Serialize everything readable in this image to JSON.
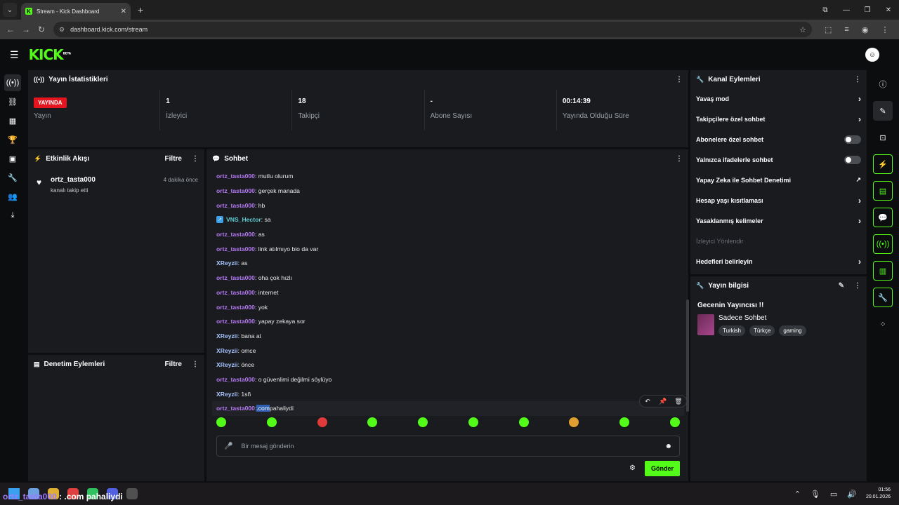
{
  "browser": {
    "tab_title": "Stream - Kick Dashboard",
    "url": "dashboard.kick.com/stream"
  },
  "logo": {
    "text": "KICK",
    "beta": "BETA"
  },
  "stats_panel": {
    "title": "Yayın İstatistikleri",
    "stats": [
      {
        "value": "YAYINDA",
        "label": "Yayın"
      },
      {
        "value": "1",
        "label": "İzleyici"
      },
      {
        "value": "18",
        "label": "Takipçi"
      },
      {
        "value": "-",
        "label": "Abone Sayısı"
      },
      {
        "value": "00:14:39",
        "label": "Yayında Olduğu Süre"
      }
    ]
  },
  "activity_panel": {
    "title": "Etkinlik Akışı",
    "filter": "Filtre",
    "item": {
      "user": "ortz_tasta000",
      "text": "kanalı takip etti",
      "time": "4 dakika önce"
    }
  },
  "moderation_panel": {
    "title": "Denetim Eylemleri",
    "filter": "Filtre"
  },
  "chat": {
    "title": "Sohbet",
    "messages": [
      {
        "user": "ortz_tasta000",
        "text": ": mutlu olurum"
      },
      {
        "user": "ortz_tasta000",
        "text": ": gerçek manada"
      },
      {
        "user": "ortz_tasta000",
        "text": ": hb"
      },
      {
        "user": "VNS_Hector",
        "text": ": sa"
      },
      {
        "user": "ortz_tasta000",
        "text": ": as"
      },
      {
        "user": "ortz_tasta000",
        "text": ": link atılmıyo bio da var"
      },
      {
        "user": "XReyzii",
        "text": ": as"
      },
      {
        "user": "ortz_tasta000",
        "text": ": oha çok hızlı"
      },
      {
        "user": "ortz_tasta000",
        "text": ": internet"
      },
      {
        "user": "ortz_tasta000",
        "text": ": yok"
      },
      {
        "user": "ortz_tasta000",
        "text": ": yapay zekaya sor"
      },
      {
        "user": "XReyzii",
        "text": ": bana at"
      },
      {
        "user": "XReyzii",
        "text": ": omce"
      },
      {
        "user": "XReyzii",
        "text": ": önce"
      },
      {
        "user": "ortz_tasta000",
        "text": ": o güvenlimi değilmi söylüyo"
      },
      {
        "user": "XReyzii",
        "text": ": 1sñ"
      },
      {
        "user": "ortz_tasta000",
        "text_sel": ".com",
        "text": " pahaliydi"
      }
    ],
    "input_placeholder": "Bir mesaj gönderin",
    "send_label": "Gönder"
  },
  "channel_actions": {
    "title": "Kanal Eylemleri",
    "rows": [
      {
        "label": "Yavaş mod"
      },
      {
        "label": "Takipçilere özel sohbet"
      },
      {
        "label": "Abonelere özel sohbet"
      },
      {
        "label": "Yalnızca ifadelerle sohbet"
      },
      {
        "label": "Yapay Zeka ile Sohbet Denetimi"
      },
      {
        "label": "Hesap yaşı kısıtlaması"
      },
      {
        "label": "Yasaklanmış kelimeler"
      },
      {
        "label": "İzleyici Yönlendir"
      },
      {
        "label": "Hedefleri belirleyin"
      }
    ]
  },
  "stream_info": {
    "title": "Yayın bilgisi",
    "stream_title": "Gecenin Yayıncısı !!",
    "category": "Sadece Sohbet",
    "tags": [
      "Turkish",
      "Türkçe",
      "gaming"
    ]
  },
  "taskbar": {
    "overlay_user": "ortz_tasta000",
    "overlay_msg": " : .com pahaliydi",
    "time": "01:56",
    "date": "20.01.2026"
  }
}
